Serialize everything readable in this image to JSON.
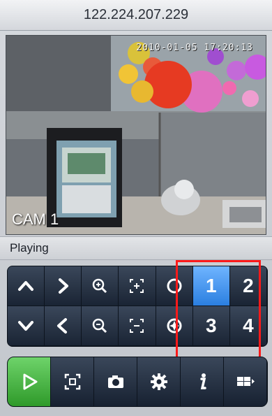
{
  "header": {
    "title": "122.224.207.229"
  },
  "video": {
    "timestamp": "2010-01-05 17:20:13",
    "camera_label": "CAM 1"
  },
  "status": {
    "text": "Playing"
  },
  "ptz": {
    "channels": [
      "1",
      "2",
      "3",
      "4"
    ],
    "active_channel": "1"
  },
  "toolbar": {
    "icons": [
      "play-icon",
      "fullscreen-icon",
      "camera-icon",
      "gear-icon",
      "info-icon",
      "layout-icon"
    ]
  },
  "colors": {
    "active_blue": "#2b7fe0",
    "play_green": "#2f9a2a",
    "highlight_red": "#ff1a1a"
  }
}
